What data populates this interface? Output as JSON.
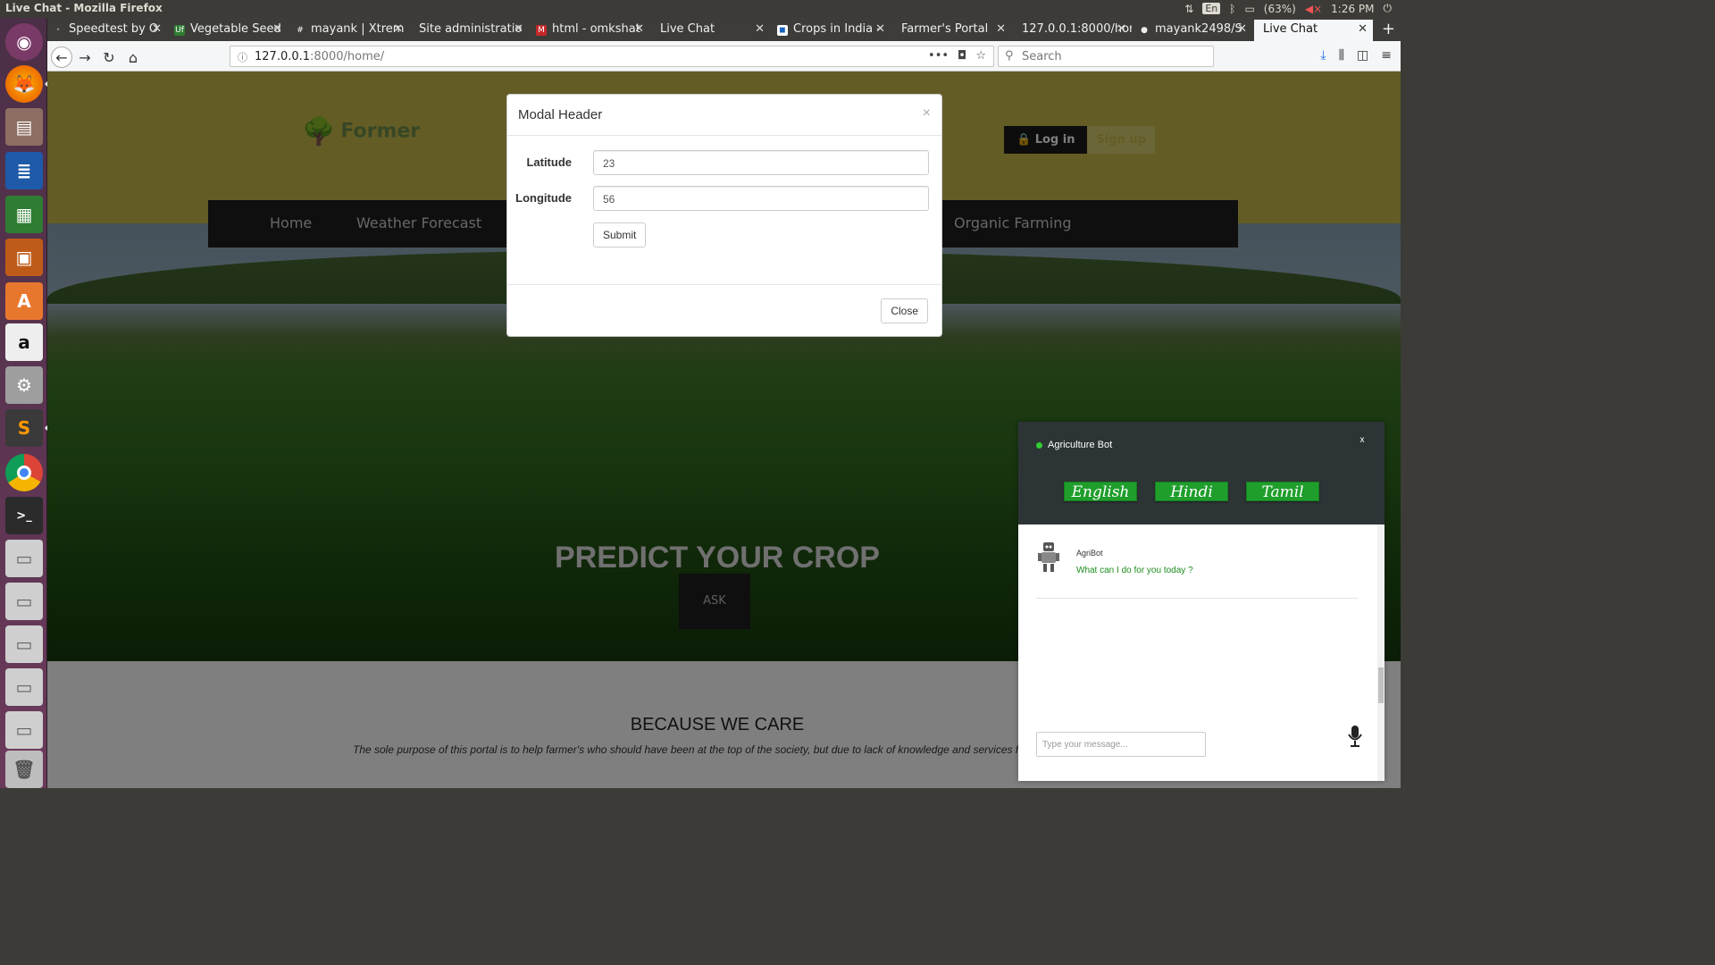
{
  "window": {
    "title": "Live Chat - Mozilla Firefox"
  },
  "tray": {
    "battery": "(63%)",
    "clock": "1:26 PM",
    "keyboard": "En"
  },
  "tabs": [
    {
      "label": "Speedtest by O",
      "fav": "•",
      "favColor": "#444"
    },
    {
      "label": "Vegetable Seed",
      "fav": "Uf",
      "favColor": "#2e7d32"
    },
    {
      "label": "mayank | Xtrem",
      "fav": "#",
      "favColor": "#555"
    },
    {
      "label": "Site administratio",
      "fav": "",
      "favColor": ""
    },
    {
      "label": "html - omkshat",
      "fav": "M",
      "favColor": "#c62828"
    },
    {
      "label": "Live Chat",
      "fav": "",
      "favColor": ""
    },
    {
      "label": "Crops in India -",
      "fav": "◼",
      "favColor": "#1565c0"
    },
    {
      "label": "Farmer's Portal",
      "fav": "",
      "favColor": ""
    },
    {
      "label": "127.0.0.1:8000/hor",
      "fav": "",
      "favColor": ""
    },
    {
      "label": "mayank2498/S",
      "fav": "●",
      "favColor": "#222"
    },
    {
      "label": "Live Chat",
      "fav": "",
      "favColor": ""
    }
  ],
  "navbar": {
    "url_host": "127.0.0.1",
    "url_rest": ":8000/home/",
    "search_placeholder": "Search"
  },
  "site": {
    "logo": "Former",
    "login": "Log in",
    "signup": "Sign up",
    "nav": [
      "Home",
      "Weather Forecast",
      "Organic Farming"
    ],
    "hero_title": "PREDICT YOUR CROP",
    "ask": "ASK",
    "care_title": "BECAUSE WE CARE",
    "care_text": "The sole purpose of this portal is to help farmer's who should have been at the top of the society, but due to lack of knowledge and services fall b"
  },
  "modal": {
    "title": "Modal Header",
    "close_x": "×",
    "latitude_label": "Latitude",
    "latitude_value": "23",
    "longitude_label": "Longitude",
    "longitude_value": "56",
    "submit": "Submit",
    "close": "Close"
  },
  "chat": {
    "bot_name": "Agriculture Bot",
    "close_x": "x",
    "languages": [
      "English",
      "Hindi",
      "Tamil"
    ],
    "sender": "AgriBot",
    "message": "What can I do for you today ?",
    "input_placeholder": "Type your message..."
  },
  "colors": {
    "accent": "#1f9e2c",
    "header": "#c8b84a",
    "chat_header": "#2d3436"
  },
  "icons": {
    "lock": "lock-icon",
    "mic": "microphone-icon",
    "robot": "robot-avatar-icon"
  }
}
